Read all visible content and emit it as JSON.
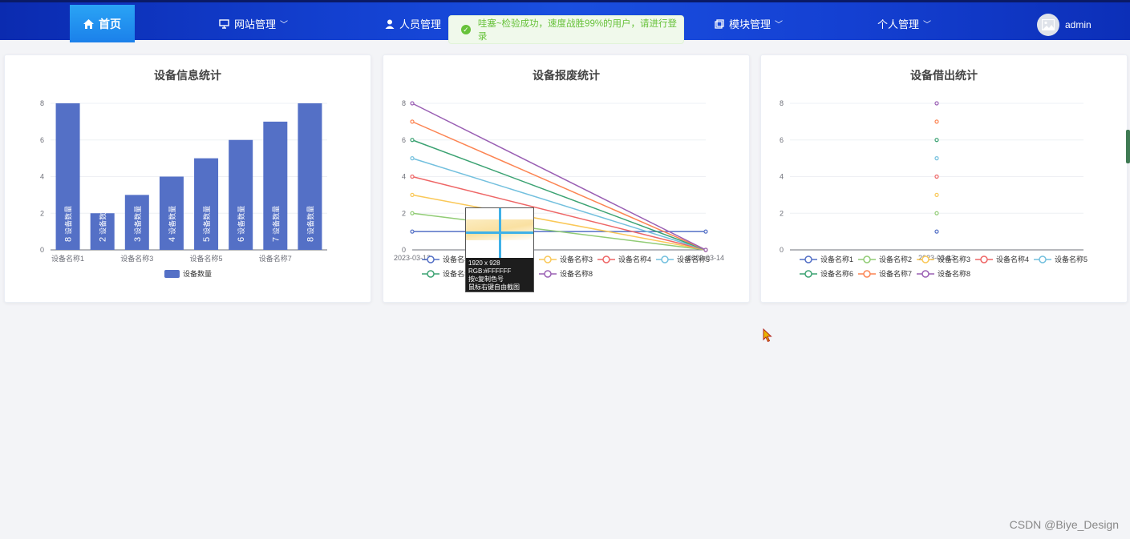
{
  "nav": {
    "home": "首页",
    "site_manage": "网站管理",
    "staff_manage": "人员管理",
    "module_manage": "模块管理",
    "personal_manage": "个人管理",
    "user": "admin"
  },
  "toast": {
    "message": "哇塞~检验成功，速度战胜99%的用户，请进行登录"
  },
  "picker": {
    "size": "1920 x 928",
    "rgb": "RGB:#FFFFFF",
    "hint1": "按c复制色号",
    "hint2": "鼠标右键自由截图"
  },
  "watermark": "CSDN @Biye_Design",
  "colors": {
    "bar": "#5470c6",
    "series": [
      "#5470c6",
      "#91cc75",
      "#fac858",
      "#ee6666",
      "#73c0de",
      "#3ba272",
      "#fc8452",
      "#9a60b4"
    ]
  },
  "chart_data": [
    {
      "type": "bar",
      "title": "设备信息统计",
      "categories": [
        "设备名称1",
        "设备名称2",
        "设备名称3",
        "设备名称4",
        "设备名称5",
        "设备名称6",
        "设备名称7",
        "设备名称8"
      ],
      "x_tick_labels_shown": [
        "设备名称1",
        "设备名称3",
        "设备名称5",
        "设备名称7"
      ],
      "series": [
        {
          "name": "设备数量",
          "values": [
            8,
            2,
            3,
            4,
            5,
            6,
            7,
            8
          ]
        }
      ],
      "bar_label_text": "设备数量",
      "ylim": [
        0,
        8
      ],
      "y_ticks": [
        0,
        2,
        4,
        6,
        8
      ],
      "legend": "bottom"
    },
    {
      "type": "line",
      "title": "设备报废统计",
      "x": [
        "2023-03-13",
        "2023-03-14"
      ],
      "series": [
        {
          "name": "设备名称1",
          "values": [
            1,
            1
          ]
        },
        {
          "name": "设备名称2",
          "values": [
            2,
            0
          ]
        },
        {
          "name": "设备名称3",
          "values": [
            3,
            0
          ]
        },
        {
          "name": "设备名称4",
          "values": [
            4,
            0
          ]
        },
        {
          "name": "设备名称5",
          "values": [
            5,
            0
          ]
        },
        {
          "name": "设备名称6",
          "values": [
            6,
            0
          ]
        },
        {
          "name": "设备名称7",
          "values": [
            7,
            0
          ]
        },
        {
          "name": "设备名称8",
          "values": [
            8,
            0
          ]
        }
      ],
      "ylim": [
        0,
        8
      ],
      "y_ticks": [
        0,
        2,
        4,
        6,
        8
      ],
      "legend": "bottom"
    },
    {
      "type": "scatter",
      "title": "设备借出统计",
      "x": [
        "2023-03-13"
      ],
      "series": [
        {
          "name": "设备名称1",
          "values": [
            1
          ]
        },
        {
          "name": "设备名称2",
          "values": [
            2
          ]
        },
        {
          "name": "设备名称3",
          "values": [
            3
          ]
        },
        {
          "name": "设备名称4",
          "values": [
            4
          ]
        },
        {
          "name": "设备名称5",
          "values": [
            5
          ]
        },
        {
          "name": "设备名称6",
          "values": [
            6
          ]
        },
        {
          "name": "设备名称7",
          "values": [
            7
          ]
        },
        {
          "name": "设备名称8",
          "values": [
            8
          ]
        }
      ],
      "ylim": [
        0,
        8
      ],
      "y_ticks": [
        0,
        2,
        4,
        6,
        8
      ],
      "legend": "bottom"
    }
  ]
}
